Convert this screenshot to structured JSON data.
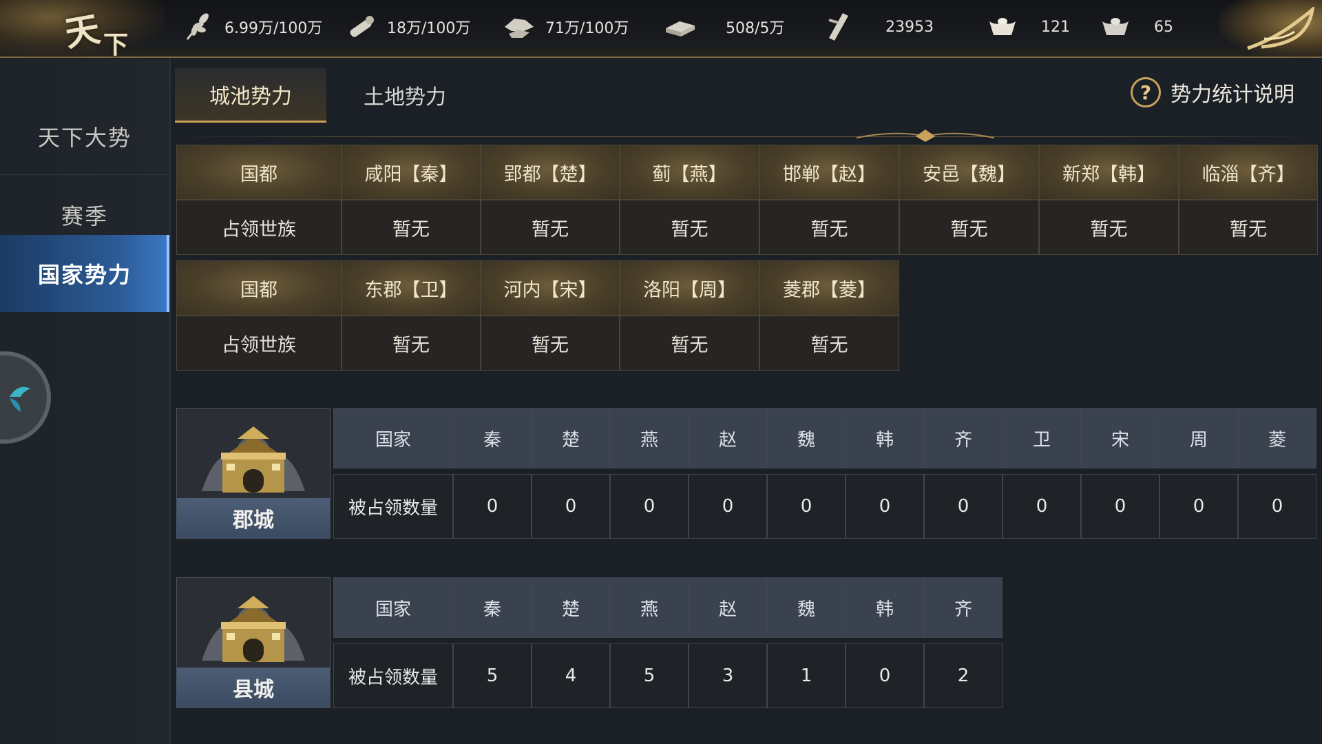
{
  "logo": {
    "char1": "天",
    "char2": "下"
  },
  "resources": [
    {
      "icon": "wheat-icon",
      "value": "6.99万/100万"
    },
    {
      "icon": "wood-icon",
      "value": "18万/100万"
    },
    {
      "icon": "stone-icon",
      "value": "71万/100万"
    },
    {
      "icon": "iron-icon",
      "value": "508/5万"
    },
    {
      "icon": "decree-icon",
      "value": "23953"
    },
    {
      "icon": "gold-ingot-icon",
      "value": "121"
    },
    {
      "icon": "silver-ingot-icon",
      "value": "65"
    }
  ],
  "sidebar": {
    "items": [
      {
        "label": "天下大势",
        "active": false
      },
      {
        "label": "赛季",
        "active": false
      },
      {
        "label": "国家势力",
        "active": true
      }
    ]
  },
  "tabs": [
    {
      "label": "城池势力",
      "active": true
    },
    {
      "label": "土地势力",
      "active": false
    }
  ],
  "help": {
    "label": "势力统计说明",
    "icon": "question-icon"
  },
  "capitals": {
    "row_label_head": "国都",
    "row_label_body": "占领世族",
    "group1": [
      {
        "city": "咸阳【秦】",
        "owner": "暂无"
      },
      {
        "city": "郢都【楚】",
        "owner": "暂无"
      },
      {
        "city": "蓟【燕】",
        "owner": "暂无"
      },
      {
        "city": "邯郸【赵】",
        "owner": "暂无"
      },
      {
        "city": "安邑【魏】",
        "owner": "暂无"
      },
      {
        "city": "新郑【韩】",
        "owner": "暂无"
      },
      {
        "city": "临淄【齐】",
        "owner": "暂无"
      }
    ],
    "group2": [
      {
        "city": "东郡【卫】",
        "owner": "暂无"
      },
      {
        "city": "河内【宋】",
        "owner": "暂无"
      },
      {
        "city": "洛阳【周】",
        "owner": "暂无"
      },
      {
        "city": "菱郡【菱】",
        "owner": "暂无"
      }
    ]
  },
  "commandery": {
    "label": "郡城",
    "head_label": "国家",
    "body_label": "被占领数量",
    "states": [
      "秦",
      "楚",
      "燕",
      "赵",
      "魏",
      "韩",
      "齐",
      "卫",
      "宋",
      "周",
      "菱"
    ],
    "counts": [
      "0",
      "0",
      "0",
      "0",
      "0",
      "0",
      "0",
      "0",
      "0",
      "0",
      "0"
    ]
  },
  "county": {
    "label": "县城",
    "head_label": "国家",
    "body_label": "被占领数量",
    "states": [
      "秦",
      "楚",
      "燕",
      "赵",
      "魏",
      "韩",
      "齐"
    ],
    "counts": [
      "5",
      "4",
      "5",
      "3",
      "1",
      "0",
      "2"
    ]
  }
}
